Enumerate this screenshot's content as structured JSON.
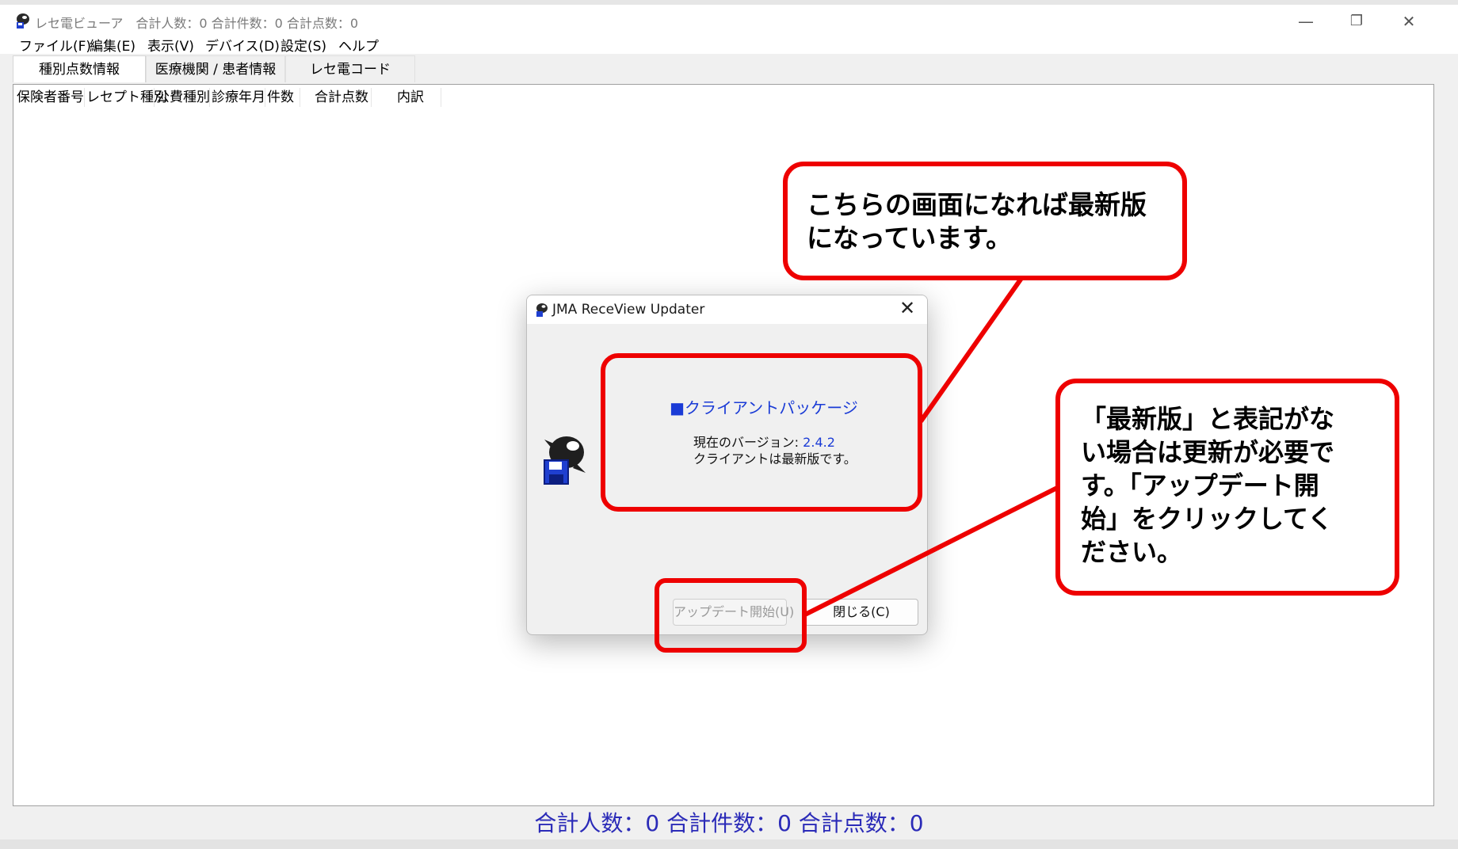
{
  "window": {
    "title": "レセ電ビューア　合計人数：0  合計件数：0  合計点数：0",
    "minimize": "—",
    "maximize": "❐",
    "close": "✕"
  },
  "menu": {
    "items": [
      "ファイル(F)",
      "編集(E)",
      "表示(V)",
      "デバイス(D)",
      "設定(S)",
      "ヘルプ"
    ]
  },
  "tabs": [
    "種別点数情報",
    "医療機関 / 患者情報",
    "レセ電コード"
  ],
  "table": {
    "columns": [
      "保険者番号",
      "レセプト種別",
      "公費種別",
      "診療年月",
      "件数",
      "合計点数",
      "内訳"
    ]
  },
  "status": {
    "text": "合計人数：0  合計件数：0  合計点数：0"
  },
  "dialog": {
    "title": "JMA ReceView Updater",
    "close": "✕",
    "package_title": "■クライアントパッケージ",
    "version_label": "現在のバージョン: ",
    "version": "2.4.2",
    "status": "クライアントは最新版です。",
    "update_button": "アップデート開始(U)",
    "close_button": "閉じる(C)"
  },
  "annotations": {
    "callout_top": "こちらの画面になれば最新版\nになっています。",
    "callout_right": "「最新版」と表記がな\nい場合は更新が必要で\nす。「アップデート開\n始」をクリックしてく\nださい。"
  },
  "colors": {
    "annotation_red": "#ee0000",
    "status_blue": "#2b2bb8",
    "link_blue": "#1a3bd6"
  }
}
